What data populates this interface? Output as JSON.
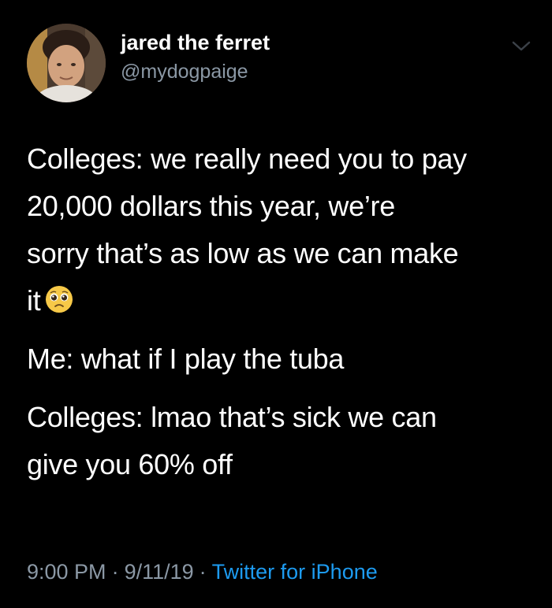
{
  "author": {
    "display_name": "jared the ferret",
    "handle": "@mydogpaige",
    "avatar": "profile-photo"
  },
  "tweet": {
    "paragraphs": [
      {
        "lines": [
          "Colleges: we really need you to pay",
          "20,000 dollars this year, we’re",
          "sorry that’s as low as we can make",
          "it"
        ],
        "trailing_emoji": "pleading-face-emoji"
      },
      {
        "lines": [
          "Me: what if I play the tuba"
        ]
      },
      {
        "lines": [
          "Colleges: lmao that’s sick we can",
          "give you 60% off"
        ]
      }
    ]
  },
  "meta": {
    "time": "9:00 PM",
    "date": "9/11/19",
    "separator": "·",
    "source": "Twitter for iPhone"
  },
  "icons": {
    "more": "chevron-down-icon"
  },
  "colors": {
    "background": "#000000",
    "text": "#ffffff",
    "secondary": "#8b98a5",
    "link": "#1d9bf0"
  }
}
